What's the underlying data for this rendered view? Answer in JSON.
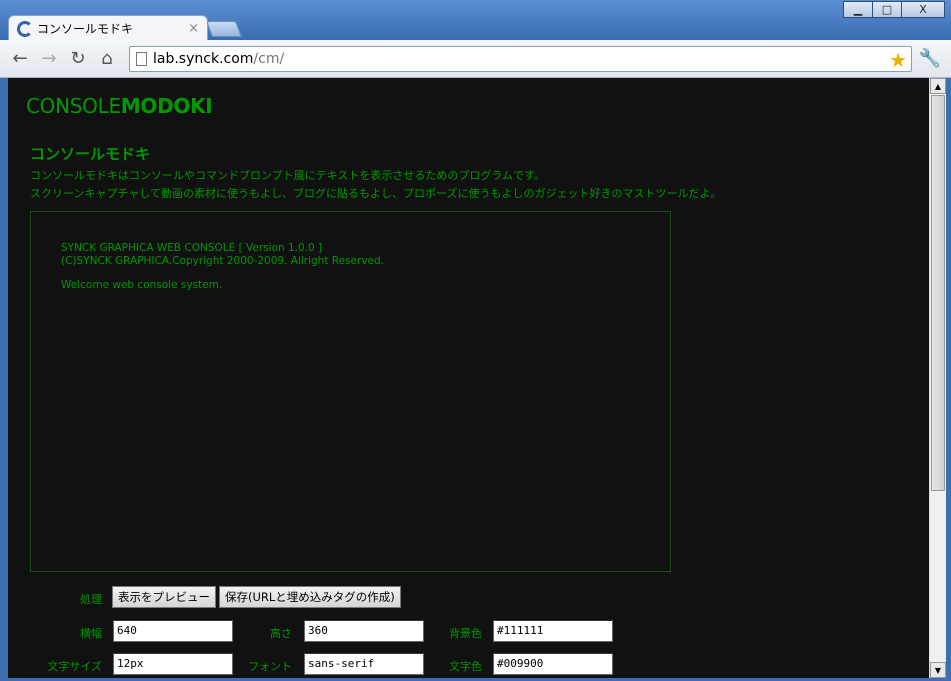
{
  "browser": {
    "tab_title": "コンソールモドキ",
    "tab_close": "×",
    "url_host": "lab.synck.com",
    "url_path": "/cm/",
    "win_minimize": "▁",
    "win_maximize": "□",
    "win_close": "X"
  },
  "page": {
    "logo_light": "CONSOLE",
    "logo_bold": "MODOKI",
    "heading": "コンソールモドキ",
    "desc_line1": "コンソールモドキはコンソールやコマンドプロンプト風にテキストを表示させるためのプログラムです。",
    "desc_line2": "スクリーンキャプチャして動画の素材に使うもよし、ブログに貼るもよし、プロポーズに使うもよしのガジェット好きのマストツールだよ。",
    "console_lines": [
      "SYNCK GRAPHICA WEB CONSOLE [ Version 1.0.0 ]",
      "(C)SYNCK GRAPHICA.Copyright 2000-2009. Allright Reserved.",
      "Welcome web console system."
    ]
  },
  "form": {
    "process_label": "処理",
    "preview_button": "表示をプレビュー",
    "save_button": "保存(URLと埋め込みタグの作成)",
    "width_label": "横幅",
    "width_value": "640",
    "height_label": "高さ",
    "height_value": "360",
    "bg_label": "背景色",
    "bg_value": "#111111",
    "fontsize_label": "文字サイズ",
    "fontsize_value": "12px",
    "font_label": "フォント",
    "font_value": "sans-serif",
    "color_label": "文字色",
    "color_value": "#009900"
  },
  "colors": {
    "page_bg": "#111111",
    "text_green": "#009900",
    "console_border": "#1e4a1e"
  },
  "icons": [
    "reload-icon",
    "back-icon",
    "forward-icon",
    "home-icon",
    "page-icon",
    "star-icon",
    "wrench-icon"
  ]
}
